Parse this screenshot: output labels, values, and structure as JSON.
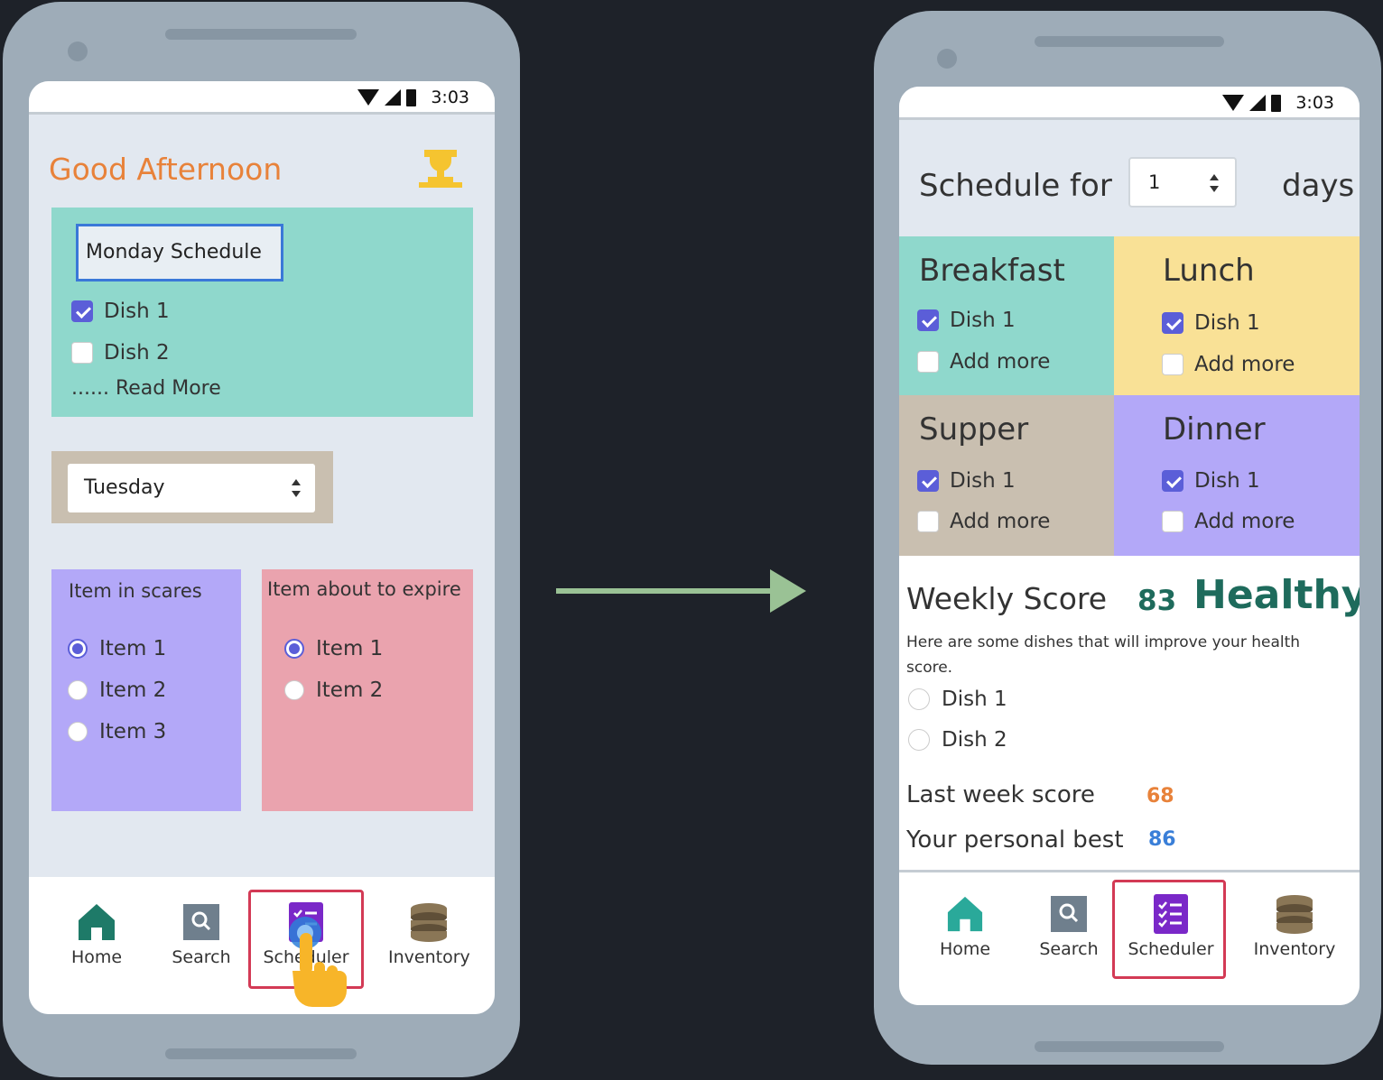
{
  "left_phone": {
    "status": {
      "time": "3:03"
    },
    "greeting": "Good Afternoon",
    "monday_card": {
      "title": "Monday Schedule",
      "items": [
        {
          "label": "Dish 1",
          "checked": true
        },
        {
          "label": "Dish 2",
          "checked": false
        }
      ],
      "read_more": "...... Read More"
    },
    "day_select": {
      "value": "Tuesday"
    },
    "scarce_card": {
      "title": "Item in scares",
      "items": [
        {
          "label": "Item 1",
          "selected": true
        },
        {
          "label": "Item 2",
          "selected": false
        },
        {
          "label": "Item 3",
          "selected": false
        }
      ]
    },
    "expire_card": {
      "title": "Item about to expire",
      "items": [
        {
          "label": "Item 1",
          "selected": true
        },
        {
          "label": "Item 2",
          "selected": false
        }
      ]
    },
    "nav": [
      {
        "label": "Home",
        "icon": "home-icon"
      },
      {
        "label": "Search",
        "icon": "search-icon"
      },
      {
        "label": "Scheduler",
        "icon": "scheduler-icon",
        "selected": true
      },
      {
        "label": "Inventory",
        "icon": "inventory-icon"
      }
    ]
  },
  "right_phone": {
    "status": {
      "time": "3:03"
    },
    "schedule_for": "Schedule for",
    "days_value": "1",
    "days_label": "days",
    "meals": [
      {
        "title": "Breakfast",
        "dish": "Dish 1",
        "add": "Add more",
        "color": "#8fd8cc"
      },
      {
        "title": "Lunch",
        "dish": "Dish 1",
        "add": "Add more",
        "color": "#f9e196"
      },
      {
        "title": "Supper",
        "dish": "Dish 1",
        "add": "Add more",
        "color": "#c9bfb0"
      },
      {
        "title": "Dinner",
        "dish": "Dish 1",
        "add": "Add more",
        "color": "#b3a8f8"
      }
    ],
    "weekly": {
      "label": "Weekly Score",
      "score": "83",
      "status": "Healthy",
      "description": "Here are some dishes that will improve your  health score.",
      "dishes": [
        "Dish 1",
        "Dish 2"
      ],
      "last_week_label": "Last week score",
      "last_week_value": "68",
      "best_label": "Your personal best",
      "best_value": "86"
    },
    "nav": [
      {
        "label": "Home",
        "icon": "home-icon"
      },
      {
        "label": "Search",
        "icon": "search-icon"
      },
      {
        "label": "Scheduler",
        "icon": "scheduler-icon",
        "selected": true
      },
      {
        "label": "Inventory",
        "icon": "inventory-icon"
      }
    ]
  },
  "colors": {
    "accent_orange": "#e8823a",
    "healthy_green": "#1e6b5c",
    "best_blue": "#3a7fd8",
    "selected_red": "#d33a55",
    "arrow_green": "#9ac295"
  }
}
